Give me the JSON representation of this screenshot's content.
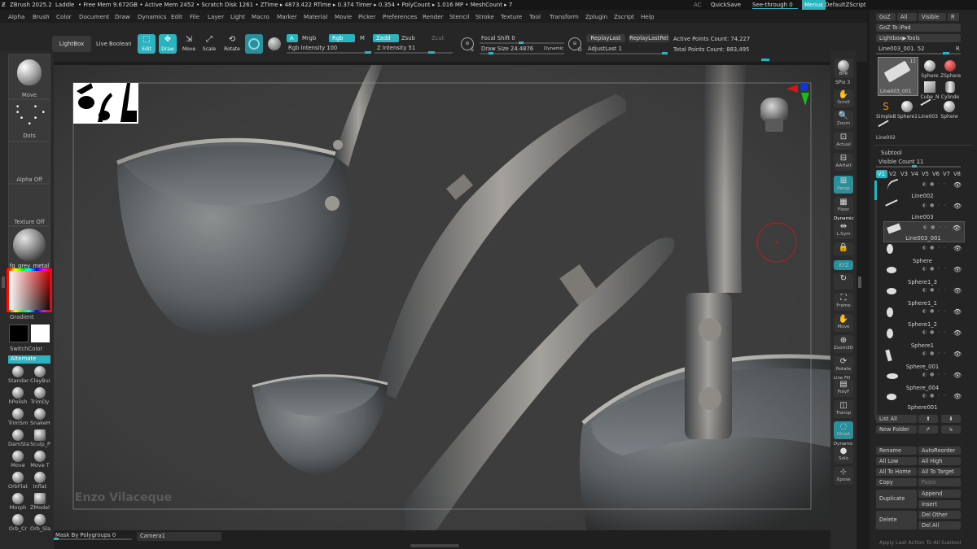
{
  "titlebar": {
    "app": "ZBrush 2025.2",
    "document": "Laddle",
    "stats": "• Free Mem 9.672GB • Active Mem 2452 • Scratch Disk 1261 • ZTime ▸ 4873.422 RTime ▸ 0.374 Timer ▸ 0.354 • PolyCount ▸ 1.016 MP • MeshCount ▸ 7",
    "ac": "AC",
    "quicksave": "QuickSave",
    "see_through": "See-through  0",
    "menus": "Menus",
    "default_script": "DefaultZScript"
  },
  "menubar": [
    "Alpha",
    "Brush",
    "Color",
    "Document",
    "Draw",
    "Dynamics",
    "Edit",
    "File",
    "Layer",
    "Light",
    "Macro",
    "Marker",
    "Material",
    "Movie",
    "Picker",
    "Preferences",
    "Render",
    "Stencil",
    "Stroke",
    "Texture",
    "Tool",
    "Transform",
    "Zplugin",
    "Zscript",
    "Help"
  ],
  "toolbar": {
    "lightbox": "LightBox",
    "live_boolean": "Live Boolean",
    "edit": "Edit",
    "draw": "Draw",
    "move": "Move",
    "scale": "Scale",
    "rotate": "Rotate",
    "a": "A",
    "mrgb": "Mrgb",
    "rgb": "Rgb",
    "m": "M",
    "zadd": "Zadd",
    "zsub": "Zsub",
    "zcut": "Zcut",
    "rgb_intensity": "Rgb Intensity 100",
    "z_intensity": "Z Intensity 51",
    "focal_shift": "Focal Shift 0",
    "draw_size": "Draw Size 24.4876",
    "dynamic": "Dynamic",
    "replay_last": "ReplayLast",
    "replay_last_rel": "ReplayLastRel",
    "adjust_last": "AdjustLast  1",
    "active_points": "Active Points Count: 74,227",
    "total_points": "Total Points Count: 883,495",
    "s": "S",
    "d": "D"
  },
  "leftshelf": {
    "move": "Move",
    "dots": "Dots",
    "alpha_off": "Alpha Off",
    "texture_off": "Texture Off",
    "material": "fg_grey_metal",
    "gradient": "Gradient",
    "switch_color": "SwitchColor",
    "alternate": "Alternate",
    "brushes": [
      "Standar",
      "ClayBui",
      "hPolish",
      "TrimDy",
      "TrimSm",
      "SnakeH",
      "DamSta",
      "Sculp_P",
      "Move",
      "Move T",
      "OrbFlat",
      "Inflat",
      "Morph",
      "ZModel",
      "Orb_Cr",
      "Orb_Sla"
    ]
  },
  "canvas": {
    "watermark": "Enzo Vilaceque"
  },
  "bottombar": {
    "mask": "Mask By Polygroups 0",
    "camera": "Camera1"
  },
  "rightstrip": [
    "BPR",
    "SPix 3",
    "Scroll",
    "Zoom",
    "Actual",
    "AAHalf",
    "Persp",
    "Floor",
    "Dynamic",
    "L.Sym",
    "",
    "XYZ",
    "",
    "Frame",
    "Move",
    "Zoom3D",
    "Rotate",
    "Line Fill",
    "PolyF",
    "Transp",
    "Ghost",
    "Dynamic",
    "Solo",
    "Xpose"
  ],
  "rightpanel": {
    "goz": "GoZ",
    "all": "All",
    "visible": "Visible",
    "r": "R",
    "goz_ipad": "GoZ To iPad",
    "lightbox_tools": "Lightbox▶Tools",
    "current_tool": "Line003_001. 52",
    "thumbs": [
      "Line003_001",
      "Sphere",
      "ZSphere",
      "SimpleB",
      "Sphere",
      "Cube_N",
      "Cylinde",
      "Sphere1",
      "Line003",
      "Sphere",
      "Line002"
    ],
    "thumb_count": "11",
    "subtool": "Subtool",
    "visible_count": "Visible Count 11",
    "versions": [
      "V1",
      "V2",
      "V3",
      "V4",
      "V5",
      "V6",
      "V7",
      "V8"
    ],
    "items": [
      "Line002",
      "Line003",
      "Line003_001",
      "Sphere",
      "Sphere1_3",
      "Sphere1_1",
      "Sphere1_2",
      "Sphere1",
      "Sphere_001",
      "Sphere_004",
      "Sphere001"
    ],
    "list_all": "List All",
    "new_folder": "New Folder",
    "rename": "Rename",
    "auto_reorder": "AutoReorder",
    "all_low": "All Low",
    "all_high": "All High",
    "all_to_home": "All To Home",
    "all_to_target": "All To Target",
    "copy": "Copy",
    "paste": "Paste",
    "duplicate": "Duplicate",
    "append": "Append",
    "insert": "Insert",
    "delete": "Delete",
    "del_other": "Del Other",
    "del_all": "Del All",
    "apply_last": "Apply Last Action To All Subtool"
  },
  "colors": {
    "accent": "#2bb3c0",
    "bg": "#262626",
    "canvas": "#3b3b3b"
  }
}
